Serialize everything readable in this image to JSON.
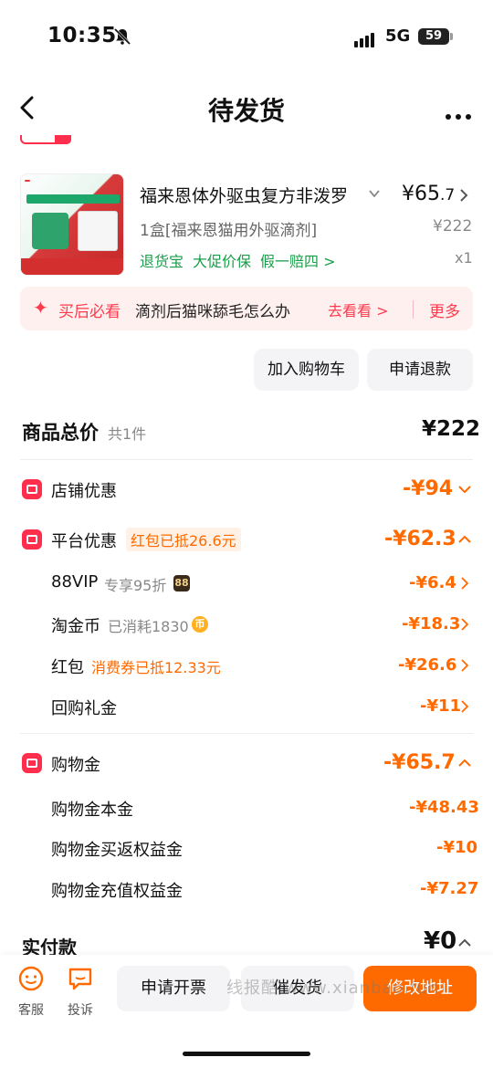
{
  "status": {
    "time": "10:35",
    "network": "5G",
    "battery": "59"
  },
  "nav": {
    "title": "待发货"
  },
  "product": {
    "title": "福来恩体外驱虫复方非泼罗",
    "price_int": "¥65",
    "price_dec": ".7",
    "spec": "1盒[福来恩猫用外驱滴剂]",
    "orig_price": "¥222",
    "tags": [
      "退货宝",
      "大促价保",
      "假一赔四 >"
    ],
    "qty": "x1"
  },
  "tip": {
    "label": "买后必看",
    "text": "滴剂后猫咪舔毛怎么办",
    "go": "去看看 >",
    "more": "更多"
  },
  "actions": {
    "add_cart": "加入购物车",
    "refund": "申请退款"
  },
  "total": {
    "label": "商品总价",
    "count": "共1件",
    "value": "¥222"
  },
  "store_discount": {
    "label": "店铺优惠",
    "value": "-¥94"
  },
  "platform_discount": {
    "label": "平台优惠",
    "tag": "红包已抵26.6元",
    "value": "-¥62.3",
    "items": [
      {
        "label": "88VIP",
        "note": "专享95折",
        "badge": "88",
        "value": "-¥6.4"
      },
      {
        "label": "淘金币",
        "note": "已消耗1830",
        "badge": "币",
        "value": "-¥18.3"
      },
      {
        "label": "红包",
        "note": "消费券已抵12.33元",
        "value": "-¥26.6"
      },
      {
        "label": "回购礼金",
        "value": "-¥11"
      }
    ]
  },
  "shopping_money": {
    "label": "购物金",
    "value": "-¥65.7",
    "items": [
      {
        "label": "购物金本金",
        "value": "-¥48.43"
      },
      {
        "label": "购物金买返权益金",
        "value": "-¥10"
      },
      {
        "label": "购物金充值权益金",
        "value": "-¥7.27"
      }
    ]
  },
  "pay": {
    "label": "实付款",
    "value": "¥0"
  },
  "bottom": {
    "service": "客服",
    "complain": "投诉",
    "invoice": "申请开票",
    "urge": "催发货",
    "modify_address": "修改地址",
    "watermark": "线报酷 www.xianbao.fun"
  },
  "colors": {
    "accent": "#ff6a00",
    "red": "#ff2e4c",
    "green": "#1a9e4a"
  }
}
